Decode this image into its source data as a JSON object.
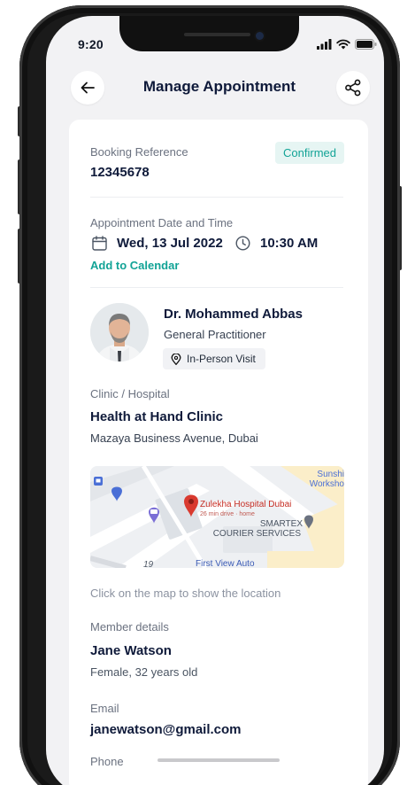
{
  "status_bar": {
    "time": "9:20"
  },
  "header": {
    "title": "Manage Appointment"
  },
  "booking": {
    "reference_label": "Booking Reference",
    "reference_value": "12345678",
    "status": "Confirmed"
  },
  "appointment": {
    "label": "Appointment Date and Time",
    "date": "Wed, 13 Jul 2022",
    "time": "10:30 AM",
    "add_to_calendar": "Add to Calendar"
  },
  "doctor": {
    "name": "Dr. Mohammed Abbas",
    "specialty": "General Practitioner",
    "visit_type": "In-Person Visit"
  },
  "clinic": {
    "label": "Clinic / Hospital",
    "name": "Health at Hand Clinic",
    "address": "Mazaya Business Avenue, Dubai"
  },
  "map": {
    "place": "Zulekha Hospital Dubai",
    "place_sub": "26 min drive · home",
    "poi1_line1": "SMARTEX",
    "poi1_line2": "COURIER SERVICES",
    "poi2": "First View Auto",
    "corner_line1": "Sunshi",
    "corner_line2": "Worksho",
    "road_label": "19",
    "hint": "Click on the map to show the location"
  },
  "member": {
    "label": "Member details",
    "name": "Jane Watson",
    "info": "Female, 32 years old"
  },
  "email": {
    "label": "Email",
    "value": "janewatson@gmail.com"
  },
  "phone": {
    "label": "Phone"
  },
  "colors": {
    "accent": "#12a396",
    "badge_bg": "#e6f5f3",
    "title": "#0f1a3a",
    "map_pin": "#d93a2f"
  }
}
